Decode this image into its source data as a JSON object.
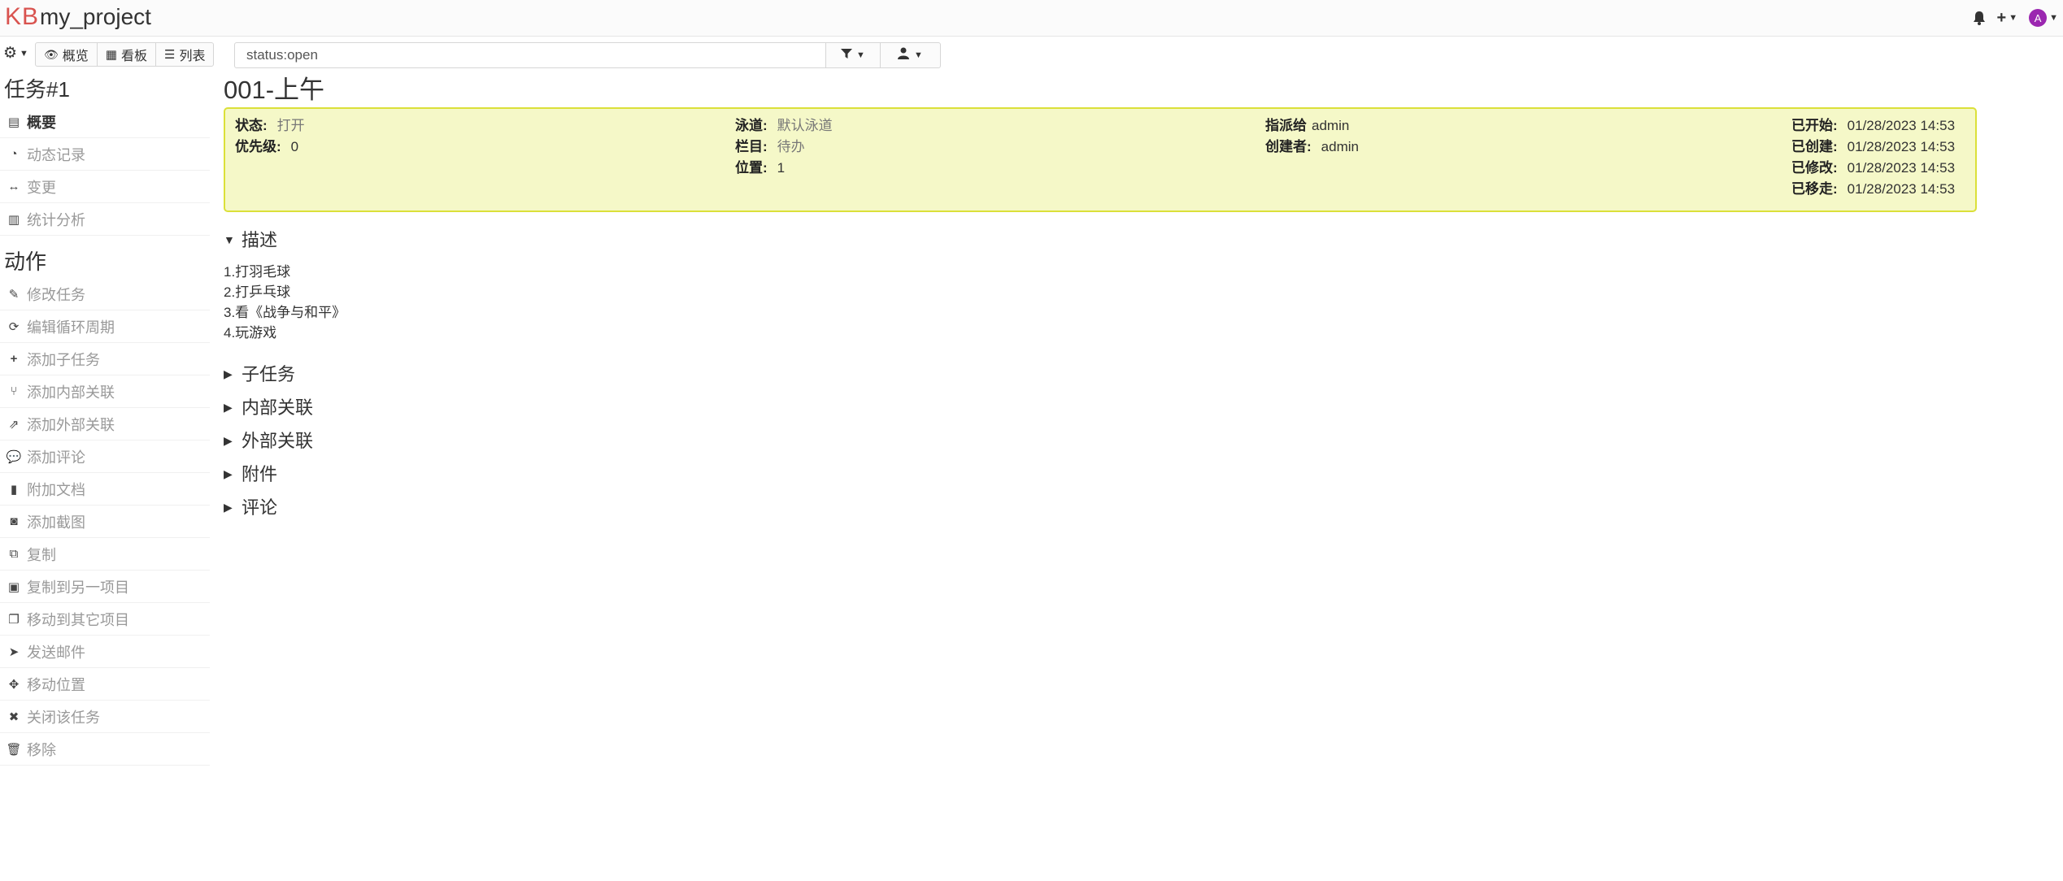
{
  "header": {
    "logo": "KB",
    "project": "my_project",
    "avatar_letter": "A",
    "icons": [
      "bell-icon",
      "plus-icon",
      "avatar"
    ]
  },
  "toolbar": {
    "views": [
      {
        "label": "概览",
        "icon": "eye-icon"
      },
      {
        "label": "看板",
        "icon": "grid-icon"
      },
      {
        "label": "列表",
        "icon": "list-icon"
      }
    ],
    "search_value": "status:open"
  },
  "sidebar": {
    "task_title": "任务#1",
    "items": [
      {
        "label": "概要",
        "icon": "newspaper-icon",
        "active": true
      },
      {
        "label": "动态记录",
        "icon": "dashboard-icon"
      },
      {
        "label": "变更",
        "icon": "arrows-h-icon"
      },
      {
        "label": "统计分析",
        "icon": "bar-chart-icon"
      }
    ],
    "actions_title": "动作",
    "actions": [
      {
        "label": "修改任务",
        "icon": "edit-icon"
      },
      {
        "label": "编辑循环周期",
        "icon": "refresh-icon"
      },
      {
        "label": "添加子任务",
        "icon": "plus-icon"
      },
      {
        "label": "添加内部关联",
        "icon": "code-fork-icon"
      },
      {
        "label": "添加外部关联",
        "icon": "external-link-icon"
      },
      {
        "label": "添加评论",
        "icon": "comment-icon"
      },
      {
        "label": "附加文档",
        "icon": "file-icon"
      },
      {
        "label": "添加截图",
        "icon": "camera-icon"
      },
      {
        "label": "复制",
        "icon": "copy-icon"
      },
      {
        "label": "复制到另一项目",
        "icon": "clipboard-icon"
      },
      {
        "label": "移动到其它项目",
        "icon": "clone-icon"
      },
      {
        "label": "发送邮件",
        "icon": "paper-plane-icon"
      },
      {
        "label": "移动位置",
        "icon": "arrows-icon"
      },
      {
        "label": "关闭该任务",
        "icon": "times-icon"
      },
      {
        "label": "移除",
        "icon": "trash-icon"
      }
    ]
  },
  "task": {
    "title": "001-上午",
    "summary": {
      "status_label": "状态:",
      "status_value": "打开",
      "priority_label": "优先级:",
      "priority_value": "0",
      "swimlane_label": "泳道:",
      "swimlane_value": "默认泳道",
      "column_label": "栏目:",
      "column_value": "待办",
      "position_label": "位置:",
      "position_value": "1",
      "assignee_label": "指派给",
      "assignee_value": "admin",
      "creator_label": "创建者:",
      "creator_value": "admin",
      "started_label": "已开始:",
      "started_value": "01/28/2023 14:53",
      "created_label": "已创建:",
      "created_value": "01/28/2023 14:53",
      "modified_label": "已修改:",
      "modified_value": "01/28/2023 14:53",
      "moved_label": "已移走:",
      "moved_value": "01/28/2023 14:53"
    },
    "description_title": "描述",
    "description_lines": [
      "1.打羽毛球",
      "2.打乒乓球",
      "3.看《战争与和平》",
      "4.玩游戏"
    ],
    "sections": [
      "子任务",
      "内部关联",
      "外部关联",
      "附件",
      "评论"
    ]
  },
  "colors": {
    "summary_bg": "#f5f8c8",
    "summary_border": "#dbe039",
    "logo": "#d9534f",
    "avatar": "#9b27b0"
  }
}
